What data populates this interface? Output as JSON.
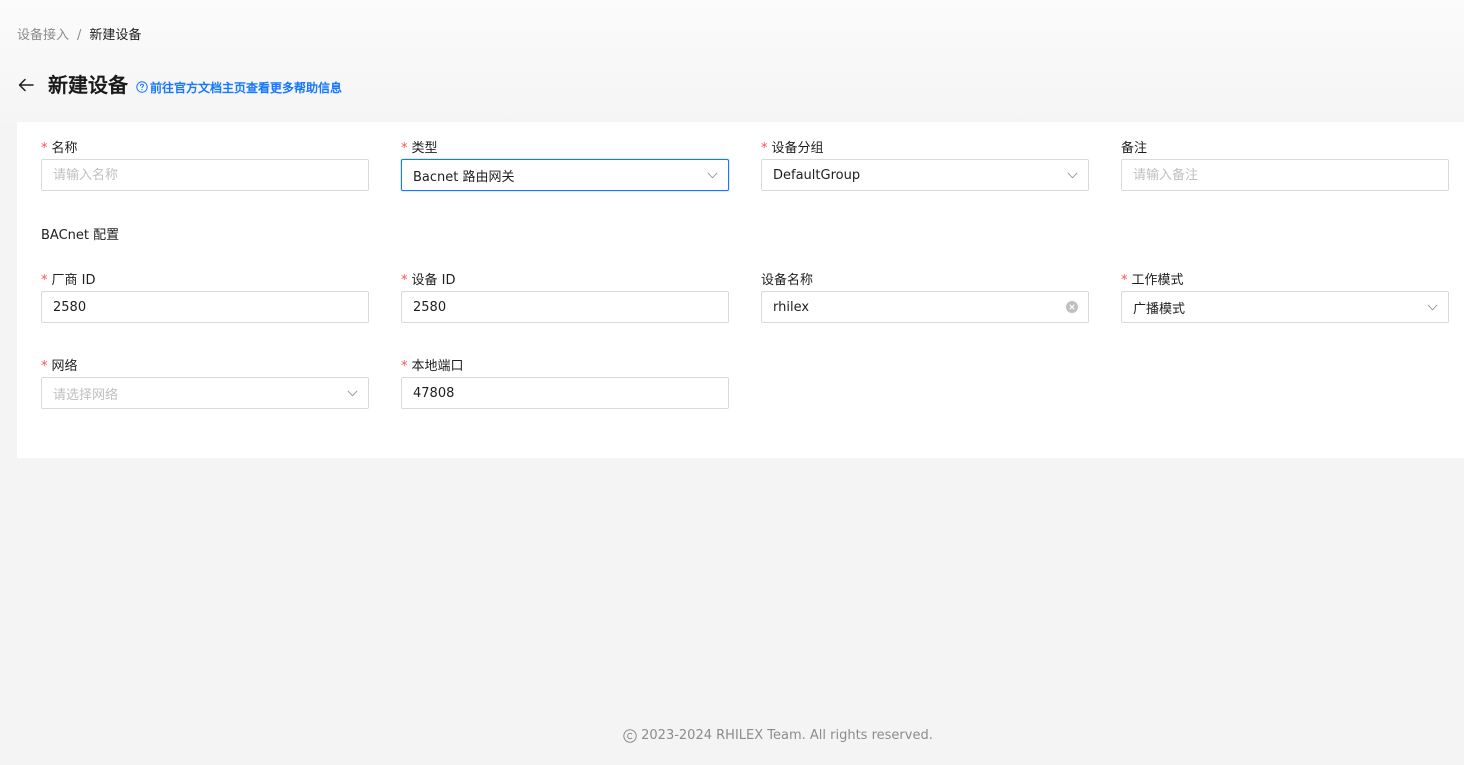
{
  "breadcrumb": {
    "parent": "设备接入",
    "separator": "/",
    "current": "新建设备"
  },
  "header": {
    "title": "新建设备",
    "help_link": "前往官方文档主页查看更多帮助信息"
  },
  "form": {
    "name": {
      "label": "名称",
      "required": "*",
      "placeholder": "请输入名称",
      "value": ""
    },
    "type": {
      "label": "类型",
      "required": "*",
      "value": "Bacnet 路由网关"
    },
    "group": {
      "label": "设备分组",
      "required": "*",
      "value": "DefaultGroup"
    },
    "remark": {
      "label": "备注",
      "placeholder": "请输入备注",
      "value": ""
    },
    "section_title": "BACnet 配置",
    "vendor_id": {
      "label": "厂商 ID",
      "required": "*",
      "value": "2580"
    },
    "device_id": {
      "label": "设备 ID",
      "required": "*",
      "value": "2580"
    },
    "device_name": {
      "label": "设备名称",
      "value": "rhilex"
    },
    "work_mode": {
      "label": "工作模式",
      "required": "*",
      "value": "广播模式"
    },
    "network": {
      "label": "网络",
      "required": "*",
      "placeholder": "请选择网络"
    },
    "local_port": {
      "label": "本地端口",
      "required": "*",
      "value": "47808"
    }
  },
  "footer": {
    "copyright": "2023-2024 RHILEX Team. All rights reserved."
  },
  "colors": {
    "accent": "#1677ff",
    "required": "#ff4d4f",
    "background": "#f4f4f4"
  }
}
